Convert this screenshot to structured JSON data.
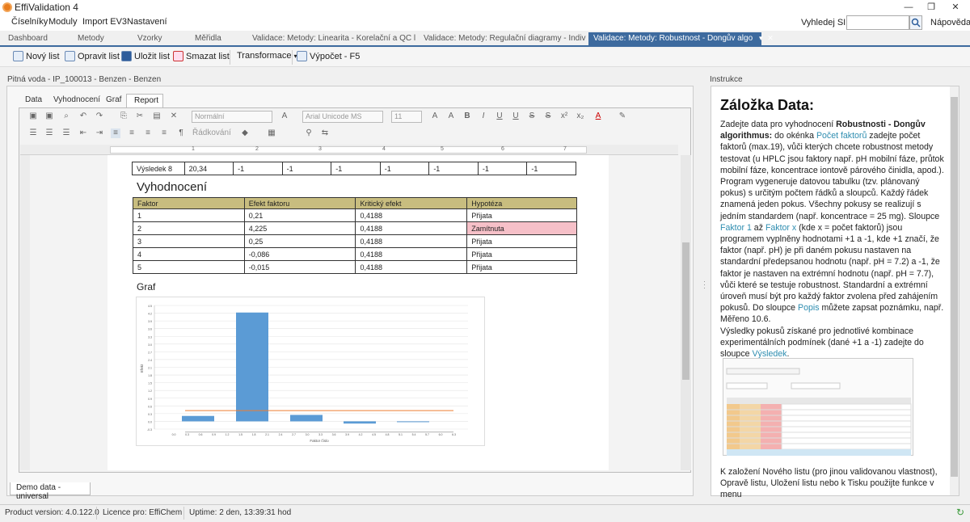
{
  "window": {
    "title": "EffiValidation 4",
    "minimize": "—",
    "restore": "❐",
    "close": "✕"
  },
  "menu": [
    "Číselníky",
    "Moduly",
    "Import EV3",
    "Nastavení"
  ],
  "search": {
    "label": "Vyhledej SID",
    "value": "",
    "help": "Nápověda"
  },
  "doc_tabs": [
    "Dashboard",
    "Metody",
    "Vzorky",
    "Měřidla",
    "Validace: Metody: Linearita - Korelační a QC l",
    "Validace: Metody: Regulační diagramy - Indiv"
  ],
  "active_tab": "Validace: Metody: Robustnost - Dongův algo",
  "toolbar": {
    "new": "Nový list",
    "edit": "Opravit list",
    "save": "Uložit list",
    "delete": "Smazat list",
    "transform": "Transformace",
    "compute": "Výpočet - F5"
  },
  "breadcrumb": "Pitná voda - IP_100013 - Benzen - Benzen",
  "instructions_label": "Instrukce",
  "subtabs": [
    "Data",
    "Vyhodnocení",
    "Graf",
    "Report"
  ],
  "format": {
    "style": "Normální",
    "font": "Arial Unicode MS",
    "size": "11",
    "para": "Řádkování"
  },
  "ruler": [
    "1",
    "2",
    "3",
    "4",
    "5",
    "6",
    "7"
  ],
  "prev_row": [
    "Výsledek 8",
    "20,34",
    "-1",
    "-1",
    "-1",
    "-1",
    "-1",
    "-1",
    "-1"
  ],
  "vyhodnoceni": {
    "title": "Vyhodnocení",
    "headers": [
      "Faktor",
      "Efekt faktoru",
      "Kritický efekt",
      "Hypotéza"
    ],
    "rows": [
      [
        "1",
        "0,21",
        "0,4188",
        "Přijata"
      ],
      [
        "2",
        "4,225",
        "0,4188",
        "Zamítnuta"
      ],
      [
        "3",
        "0,25",
        "0,4188",
        "Přijata"
      ],
      [
        "4",
        "-0,086",
        "0,4188",
        "Přijata"
      ],
      [
        "5",
        "-0,015",
        "0,4188",
        "Přijata"
      ]
    ],
    "reject_color": "#f6c0c8"
  },
  "graf_title": "Graf",
  "chart_data": {
    "type": "bar",
    "categories": [
      "1",
      "2",
      "3",
      "4",
      "5"
    ],
    "values": [
      0.21,
      4.225,
      0.25,
      -0.086,
      -0.015
    ],
    "critical": 0.4188,
    "ylim": [
      -0.3,
      4.5
    ],
    "xlabel": "Faktor číslo",
    "ylabel": "Efekt",
    "bar_color": "#5b9bd5",
    "line_color": "#ed7d31"
  },
  "bottom_tab": "Demo data - universal",
  "instructions": {
    "heading": "Záložka Data:",
    "footer": "K založení Nového listu (pro jinou validovanou vlastnost), Opravě listu, Uložení listu nebo k Tisku použijte funkce v menu"
  },
  "status": [
    "Product version: 4.0.122.0",
    "Licence pro: EffiChem",
    "Uptime: 2 den, 13:39:31 hod"
  ]
}
